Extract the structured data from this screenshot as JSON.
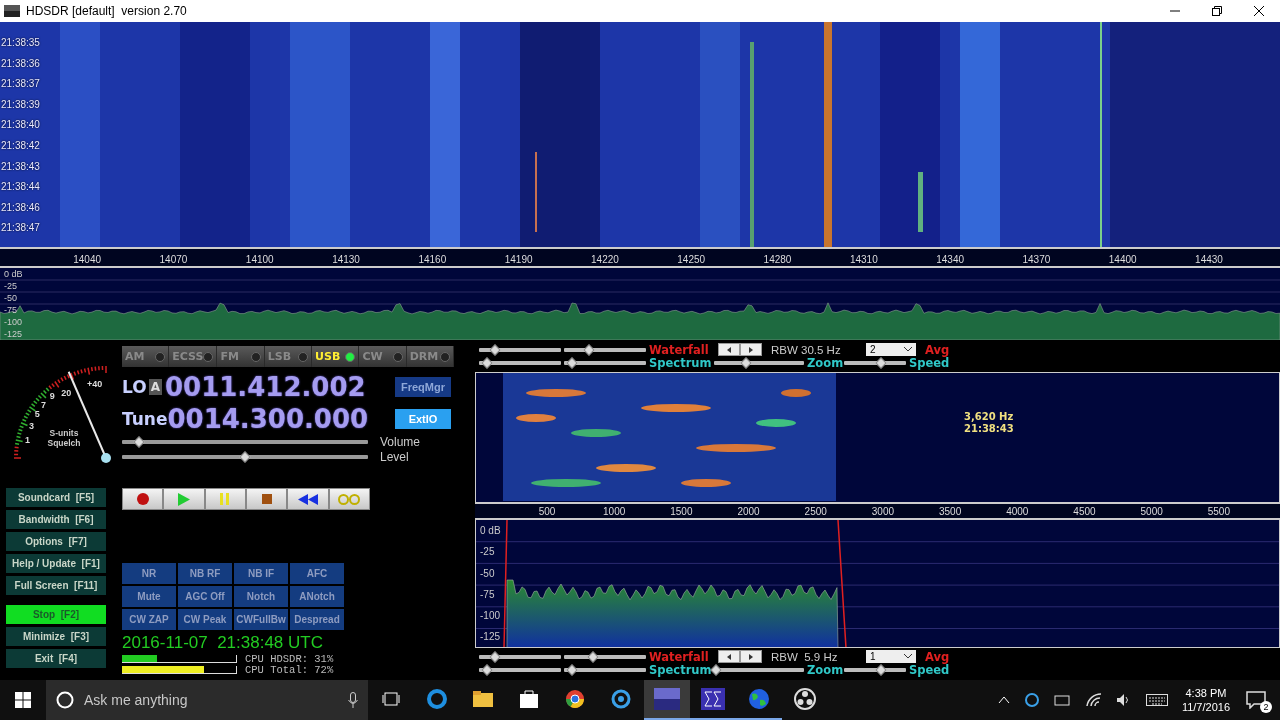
{
  "window": {
    "title": "HDSDR [default]  version 2.70"
  },
  "waterfall": {
    "kind": "picture",
    "times": [
      "21:38:35",
      "21:38:36",
      "21:38:37",
      "21:38:39",
      "21:38:40",
      "21:38:42",
      "21:38:43",
      "21:38:44",
      "21:38:46",
      "21:38:47"
    ]
  },
  "frequency_axis": [
    "14040",
    "14070",
    "14100",
    "14130",
    "14160",
    "14190",
    "14220",
    "14250",
    "14280",
    "14310",
    "14340",
    "14370",
    "14400",
    "14430"
  ],
  "spectrum": {
    "db_labels": [
      "0 dB",
      "-25",
      "-50",
      "-75",
      "-100",
      "-125"
    ]
  },
  "s_meter": {
    "level": 0.74,
    "scale": [
      "1",
      "3",
      "5",
      "7",
      "9",
      "20",
      "+40"
    ],
    "caption": [
      "S-units",
      "Squelch"
    ]
  },
  "modes": [
    {
      "label": "AM",
      "selected": false
    },
    {
      "label": "ECSS",
      "selected": false
    },
    {
      "label": "FM",
      "selected": false
    },
    {
      "label": "LSB",
      "selected": false
    },
    {
      "label": "USB",
      "selected": true
    },
    {
      "label": "CW",
      "selected": false
    },
    {
      "label": "DRM",
      "selected": false
    }
  ],
  "lo": {
    "label": "LO",
    "bank": "A",
    "value": "0011.412.002"
  },
  "tune": {
    "label": "Tune",
    "value": "0014.300.000"
  },
  "side_buttons": [
    {
      "label": "FreqMgr",
      "selected": false
    },
    {
      "label": "ExtIO",
      "selected": true
    }
  ],
  "sliders": [
    {
      "label": "Volume",
      "level": 0.07
    },
    {
      "label": "Level",
      "level": 0.5
    }
  ],
  "transport": [
    {
      "kind": "record"
    },
    {
      "kind": "play"
    },
    {
      "kind": "pause"
    },
    {
      "kind": "stop"
    },
    {
      "kind": "rewind"
    },
    {
      "kind": "loop"
    }
  ],
  "function_buttons": [
    {
      "label": "Soundcard",
      "key": "[F5]",
      "selected": false
    },
    {
      "label": "Bandwidth",
      "key": "[F6]",
      "selected": false
    },
    {
      "label": "Options",
      "key": "[F7]",
      "selected": false
    },
    {
      "label": "Help / Update",
      "key": "[F1]",
      "selected": false
    },
    {
      "label": "Full Screen",
      "key": "[F11]",
      "selected": false
    },
    {
      "label": "Stop",
      "key": "[F2]",
      "selected": true
    },
    {
      "label": "Minimize",
      "key": "[F3]",
      "selected": false
    },
    {
      "label": "Exit",
      "key": "[F4]",
      "selected": false
    }
  ],
  "dsp_buttons": [
    "NR",
    "NB RF",
    "NB IF",
    "AFC",
    "Mute",
    "AGC Off",
    "Notch",
    "ANotch",
    "CW ZAP",
    "CW Peak",
    "CWFullBw",
    "Despread"
  ],
  "clock": "2016-11-07  21:38:48 UTC",
  "cpu": [
    {
      "label": "CPU HDSDR: 31%",
      "level": 0.31,
      "color": "#22cc22"
    },
    {
      "label": "CPU Total: 72%",
      "level": 0.72,
      "color": "#eeee22"
    }
  ],
  "audio_top_controls": {
    "sliders": [
      {
        "level": 0.2
      },
      {
        "level": 0.3
      },
      {
        "level": 0.1
      },
      {
        "level": 0.1
      }
    ],
    "waterfall_label": "Waterfall",
    "rbw": "RBW 30.5 Hz",
    "avg_value": "2",
    "avg_label": "Avg",
    "spectrum_label": "Spectrum",
    "zoom": {
      "label": "Zoom",
      "level": 0.35
    },
    "speed": {
      "label": "Speed",
      "level": 0.6
    }
  },
  "audio_waterfall": {
    "kind": "picture",
    "cursor_frequency": "3,620 Hz",
    "cursor_time": "21:38:43"
  },
  "audio_axis": [
    "500",
    "1000",
    "1500",
    "2000",
    "2500",
    "3000",
    "3500",
    "4000",
    "4500",
    "5000",
    "5500"
  ],
  "audio_spectrum": {
    "db_labels": [
      "0 dB",
      "-25",
      "-50",
      "-75",
      "-100",
      "-125"
    ]
  },
  "audio_bottom_controls": {
    "sliders": [
      {
        "level": 0.2
      },
      {
        "level": 0.35
      },
      {
        "level": 0.1
      },
      {
        "level": 0.1
      }
    ],
    "waterfall_label": "Waterfall",
    "rbw": "RBW  5.9 Hz",
    "avg_value": "1",
    "avg_label": "Avg",
    "spectrum_label": "Spectrum",
    "zoom": {
      "label": "Zoom",
      "level": 0.02
    },
    "speed": {
      "label": "Speed",
      "level": 0.6
    }
  },
  "taskbar": {
    "search_placeholder": "Ask me anything",
    "apps": [
      {
        "kind": "taskview",
        "running": false,
        "selected": false
      },
      {
        "kind": "edge",
        "running": false,
        "selected": false
      },
      {
        "kind": "folder",
        "running": false,
        "selected": false
      },
      {
        "kind": "store",
        "running": false,
        "selected": false
      },
      {
        "kind": "chrome",
        "running": false,
        "selected": false
      },
      {
        "kind": "cleaner",
        "running": false,
        "selected": false
      },
      {
        "kind": "hdsdr",
        "running": true,
        "selected": true
      },
      {
        "kind": "sigma",
        "running": true,
        "selected": false
      },
      {
        "kind": "globe",
        "running": true,
        "selected": false
      },
      {
        "kind": "obs",
        "running": false,
        "selected": false
      }
    ],
    "time": "4:38 PM",
    "date": "11/7/2016",
    "notifications": "2"
  }
}
